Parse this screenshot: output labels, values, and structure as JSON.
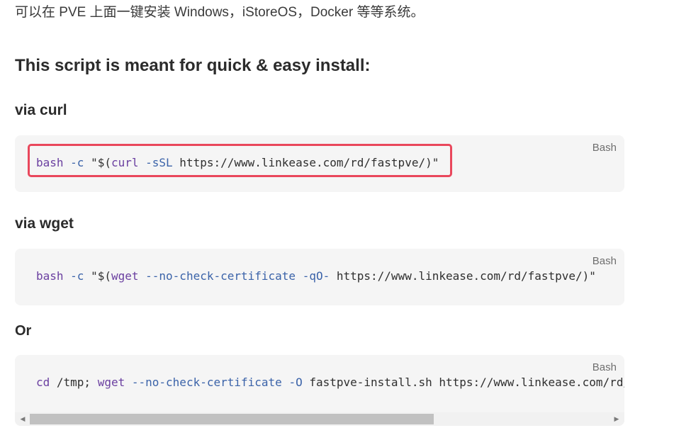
{
  "intro_text": "可以在 PVE 上面一键安装 Windows，iStoreOS，Docker 等等系统。",
  "section_heading": "This script is meant for quick & easy install:",
  "curl": {
    "heading": "via curl",
    "lang": "Bash",
    "tokens": [
      "bash",
      " ",
      "-c",
      " \"$(",
      "curl",
      " ",
      "-sSL",
      " https://www.linkease.com/rd/fastpve/)\""
    ]
  },
  "wget": {
    "heading": "via wget",
    "lang": "Bash",
    "tokens": [
      "bash",
      " ",
      "-c",
      " \"$(",
      "wget",
      " ",
      "--no-check-certificate",
      " ",
      "-qO-",
      " https://www.linkease.com/rd/fastpve/)\""
    ]
  },
  "or": {
    "text": "Or",
    "lang": "Bash",
    "tokens": [
      "cd",
      " /tmp; ",
      "wget",
      " ",
      "--no-check-certificate",
      " ",
      "-O",
      " fastpve-install.sh https://www.linkease.com/rd/fastpve/"
    ]
  },
  "scrollbar": {
    "left_arrow": "◀",
    "right_arrow": "▶"
  }
}
